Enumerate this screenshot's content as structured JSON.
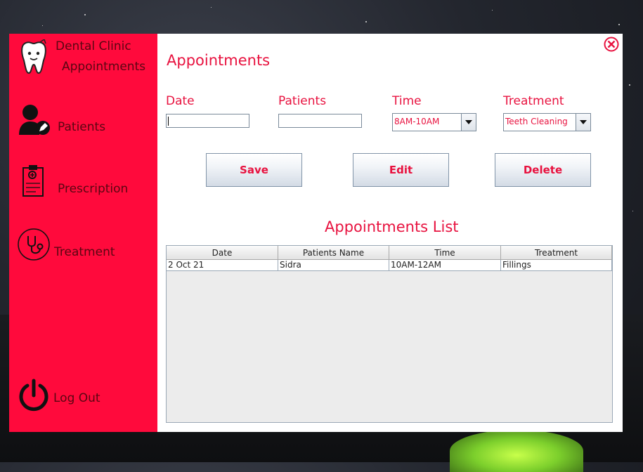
{
  "sidebar": {
    "brand_line1": "Dental Clinic",
    "brand_line2": "Appointments",
    "items": [
      {
        "label": "Patients",
        "icon": "patient-icon"
      },
      {
        "label": "Prescription",
        "icon": "clipboard-icon"
      },
      {
        "label": "Treatment",
        "icon": "stethoscope-icon"
      }
    ],
    "logout_label": "Log Out"
  },
  "main": {
    "title": "Appointments",
    "form": {
      "date_label": "Date",
      "date_value": "",
      "patients_label": "Patients",
      "patients_value": "",
      "time_label": "Time",
      "time_selected": "8AM-10AM",
      "treatment_label": "Treatment",
      "treatment_selected": "Teeth Cleaning"
    },
    "buttons": {
      "save": "Save",
      "edit": "Edit",
      "delete": "Delete"
    },
    "list_title": "Appointments List",
    "table": {
      "headers": [
        "Date",
        "Patients Name",
        "Time",
        "Treatment"
      ],
      "rows": [
        [
          "2 Oct 21",
          "Sidra",
          "10AM-12AM",
          "Fillings"
        ]
      ]
    }
  },
  "colors": {
    "accent": "#ff0a3c",
    "text_accent": "#e8123f",
    "sidebar_text": "#5a0612"
  }
}
